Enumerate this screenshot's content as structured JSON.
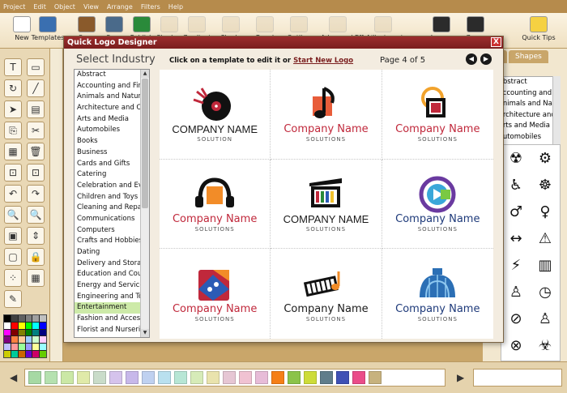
{
  "menubar": [
    "Project",
    "Edit",
    "Object",
    "View",
    "Arrange",
    "Filters",
    "Help"
  ],
  "toolbar": [
    {
      "label": "New",
      "icon": "new-page-icon",
      "dim": false
    },
    {
      "label": "Templates",
      "icon": "templates-icon",
      "dim": false
    },
    {
      "label": "Open",
      "icon": "open-folder-icon",
      "dim": false
    },
    {
      "label": "Save",
      "icon": "save-icon",
      "dim": false
    },
    {
      "label": "Publish",
      "icon": "globe-icon",
      "dim": false
    },
    {
      "label": "Shadow",
      "icon": "shadow-icon",
      "dim": true
    },
    {
      "label": "Gradient",
      "icon": "gradient-icon",
      "dim": true
    },
    {
      "label": "Shade",
      "icon": "shade-icon",
      "dim": true
    },
    {
      "label": "Bevel",
      "icon": "bevel-icon",
      "dim": true
    },
    {
      "label": "Outline",
      "icon": "outline-icon",
      "dim": true
    },
    {
      "label": "Advanced Effects",
      "icon": "advanced-effects-icon",
      "dim": true
    },
    {
      "label": "Adjustments",
      "icon": "adjustments-icon",
      "dim": true
    },
    {
      "label": "Layers",
      "icon": "layers-icon",
      "dim": false
    },
    {
      "label": "Group",
      "icon": "group-icon",
      "dim": false
    },
    {
      "label": "Quick Tips",
      "icon": "lightbulb-icon",
      "dim": false
    }
  ],
  "dialog": {
    "title": "Quick Logo Designer",
    "close_label": "X",
    "select_industry": "Select Industry",
    "instruction": "Click on a template to edit it or",
    "start_new": "Start New Logo",
    "page_label": "Page 4 of 5",
    "prev_label": "◀",
    "next_label": "▶"
  },
  "industries": [
    "Abstract",
    "Accounting and Finance",
    "Animals and Nature",
    "Architecture and Construction",
    "Arts and Media",
    "Automobiles",
    "Books",
    "Business",
    "Cards and Gifts",
    "Catering",
    "Celebration and Events",
    "Children and Toys",
    "Cleaning and Repair",
    "Communications",
    "Computers",
    "Crafts and Hobbies",
    "Dating",
    "Delivery and Storage",
    "Education and Counseling",
    "Energy and Services",
    "Engineering and Tools",
    "Entertainment",
    "Fashion and Accessories",
    "Florist and Nurseries"
  ],
  "selected_industry": "Entertainment",
  "templates": [
    {
      "mark": "vinyl-record-icon",
      "name": "COMPANY NAME",
      "sub": "SOLUTION",
      "name_color": "#1a1a1a",
      "caps": true
    },
    {
      "mark": "music-note-icon",
      "name": "Company Name",
      "sub": "SOLUTIONS",
      "name_color": "#c0283b",
      "caps": false
    },
    {
      "mark": "film-reel-icon",
      "name": "Company Name",
      "sub": "SOLUTIONS",
      "name_color": "#c0283b",
      "caps": false
    },
    {
      "mark": "headphones-icon",
      "name": "Company Name",
      "sub": "SOLUTIONS",
      "name_color": "#c0283b",
      "caps": false
    },
    {
      "mark": "clapperboard-icon",
      "name": "COMPANY NAME",
      "sub": "SOLUTIONS",
      "name_color": "#1a1a1a",
      "caps": true
    },
    {
      "mark": "play-circle-icon",
      "name": "Company Name",
      "sub": "SOLUTIONS",
      "name_color": "#1e3a7a",
      "caps": false
    },
    {
      "mark": "dice-icon",
      "name": "Company Name",
      "sub": "SOLUTIONS",
      "name_color": "#c0283b",
      "caps": false
    },
    {
      "mark": "piano-icon",
      "name": "Company Name",
      "sub": "SOLUTIONS",
      "name_color": "#1a1a1a",
      "caps": false
    },
    {
      "mark": "dome-icon",
      "name": "Company Name",
      "sub": "SOLUTIONS",
      "name_color": "#1e3a7a",
      "caps": false
    }
  ],
  "right_panel": {
    "tabs": [
      "",
      "Shapes"
    ],
    "categories": [
      "Abstract",
      "Accounting and Finance",
      "Animals and Nature",
      "Architecture and Construction",
      "Arts and Media",
      "Automobiles"
    ],
    "shapes": [
      "☢",
      "⚙",
      "♿",
      "☸",
      "♂",
      "♀",
      "↔",
      "⚠",
      "⚡",
      "▥",
      "♙",
      "◷",
      "⊘",
      "♙",
      "⊗",
      "☣",
      "✹",
      "✷"
    ]
  },
  "left_tools": [
    "T",
    "▭",
    "↻",
    "╱",
    "➤",
    "▤",
    "⎘",
    "✂",
    "▦",
    "🗑",
    "⊡",
    "⊡",
    "↶",
    "↷",
    "🔍",
    "🔍",
    "▣",
    "⇕",
    "▢",
    "🔒",
    "⁘",
    "▦",
    "✎"
  ],
  "palette_colors": [
    "#000000",
    "#404040",
    "#606060",
    "#808080",
    "#a0a0a0",
    "#c0c0c0",
    "#ffffff",
    "#ff0000",
    "#ffff00",
    "#00ff00",
    "#00ffff",
    "#0000ff",
    "#ff00ff",
    "#800000",
    "#808000",
    "#008000",
    "#008080",
    "#000080",
    "#800080",
    "#ff8040",
    "#ffcc99",
    "#99ccff",
    "#ccffcc",
    "#ffccff",
    "#c0c0ff",
    "#ff9999",
    "#99ff99",
    "#9999ff",
    "#ffff99",
    "#99ffff",
    "#cccc00",
    "#00cc99",
    "#cc6600",
    "#6600cc",
    "#cc0066",
    "#66cc00"
  ],
  "bottom_swatches": [
    "#a6d9a4",
    "#b5e1b0",
    "#cbe8a6",
    "#e0eaa9",
    "#c9dcc9",
    "#d5c3ec",
    "#c7b8ea",
    "#bfd1f0",
    "#b9e0ef",
    "#b7e6d5",
    "#d6ebb8",
    "#e9e3ad",
    "#e6c6d4",
    "#f0c2d2",
    "#e7bcd8",
    "#f57f17",
    "#8bc34a",
    "#cddc39",
    "#607d8b",
    "#3f51b5",
    "#ea4c89",
    "#c7b27e"
  ]
}
